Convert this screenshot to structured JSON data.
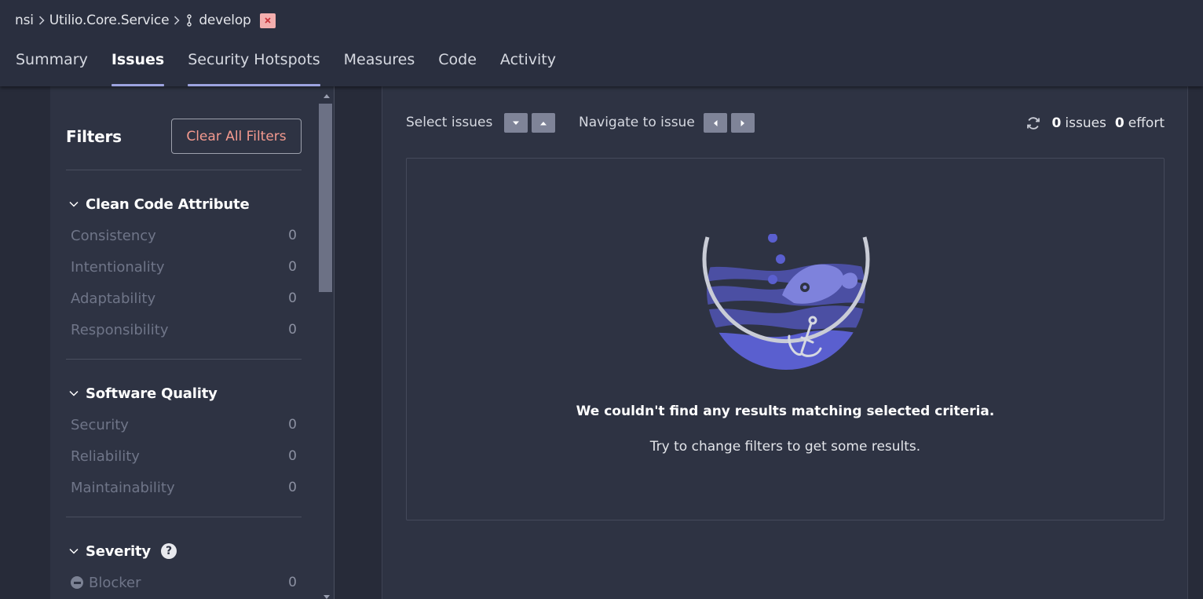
{
  "breadcrumb": {
    "org": "nsi",
    "project": "Utilio.Core.Service",
    "branch": "develop"
  },
  "tabs": [
    {
      "label": "Summary"
    },
    {
      "label": "Issues"
    },
    {
      "label": "Security Hotspots"
    },
    {
      "label": "Measures"
    },
    {
      "label": "Code"
    },
    {
      "label": "Activity"
    }
  ],
  "sidebar": {
    "title": "Filters",
    "clear_label": "Clear All Filters",
    "facets": [
      {
        "title": "Clean Code Attribute",
        "items": [
          {
            "label": "Consistency",
            "count": "0"
          },
          {
            "label": "Intentionality",
            "count": "0"
          },
          {
            "label": "Adaptability",
            "count": "0"
          },
          {
            "label": "Responsibility",
            "count": "0"
          }
        ]
      },
      {
        "title": "Software Quality",
        "items": [
          {
            "label": "Security",
            "count": "0"
          },
          {
            "label": "Reliability",
            "count": "0"
          },
          {
            "label": "Maintainability",
            "count": "0"
          }
        ]
      },
      {
        "title": "Severity",
        "help": "?",
        "items": [
          {
            "label": "Blocker",
            "count": "0",
            "icon": "blocker-icon"
          }
        ]
      }
    ]
  },
  "toolbar": {
    "select_label": "Select issues",
    "navigate_label": "Navigate to issue",
    "issues_count": "0",
    "issues_label": "issues",
    "effort_count": "0",
    "effort_label": "effort"
  },
  "empty_state": {
    "title": "We couldn't find any results matching selected criteria.",
    "subtitle": "Try to change filters to get some results."
  },
  "colors": {
    "accent_tab": "#9da3df",
    "clear_text": "#f49a8f",
    "branch_badge": "#f3aeae",
    "illustration_primary": "#5a5fcf"
  }
}
